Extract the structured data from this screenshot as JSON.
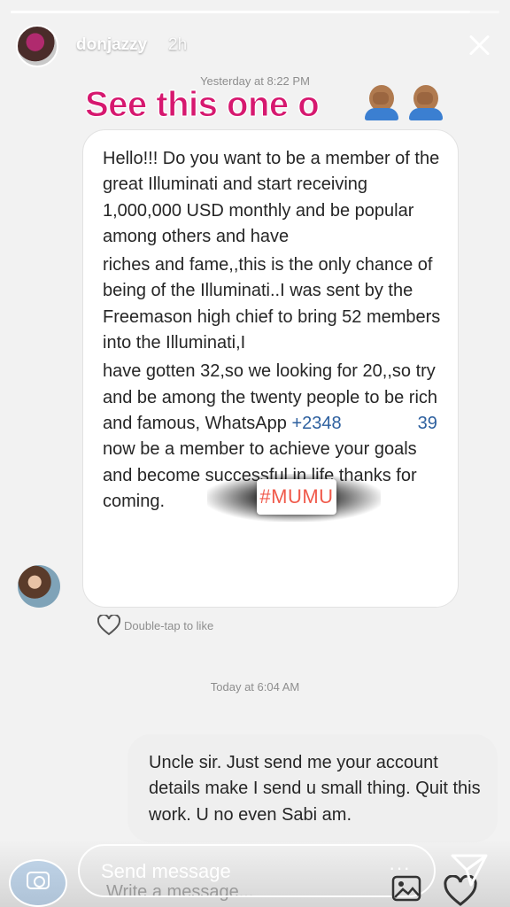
{
  "story": {
    "progress": 0.94,
    "username": "donjazzy",
    "time_ago": "2h"
  },
  "sticker_text": "See this one o",
  "thread": {
    "stamp_1": "Yesterday at 8:22 PM",
    "incoming_message": {
      "p1": "Hello!!! Do you want to be a member of the great Illuminati and start receiving 1,000,000 USD monthly and be popular among others and have",
      "p2": "riches and fame,,this is the only chance of being of the Illuminati..I was sent by the Freemason high chief to bring 52 members into the Illuminati,I",
      "p3_before_phone": "have gotten 32,so we looking for 20,,so try and be among the twenty people to be rich and famous, WhatsApp ",
      "phone_start": "+2348",
      "phone_end": "39",
      "p3_after_phone": " now be a member to achieve your goals and become successful in life thanks for coming."
    },
    "redaction_tag": "#MUMU",
    "like_hint": "Double-tap to like",
    "stamp_2": "Today at 6:04 AM",
    "outgoing_message": "Uncle sir. Just send me your account details make I send u small thing. Quit this work. U no even Sabi am."
  },
  "footer": {
    "send_placeholder": "Send message",
    "more": "···",
    "write_placeholder": "Write a message..."
  },
  "icons": {
    "close": "close-icon",
    "camera": "camera-icon",
    "send": "paper-plane-icon",
    "gallery": "gallery-icon",
    "heart": "heart-icon",
    "emoji": "facepalm-emoji"
  }
}
